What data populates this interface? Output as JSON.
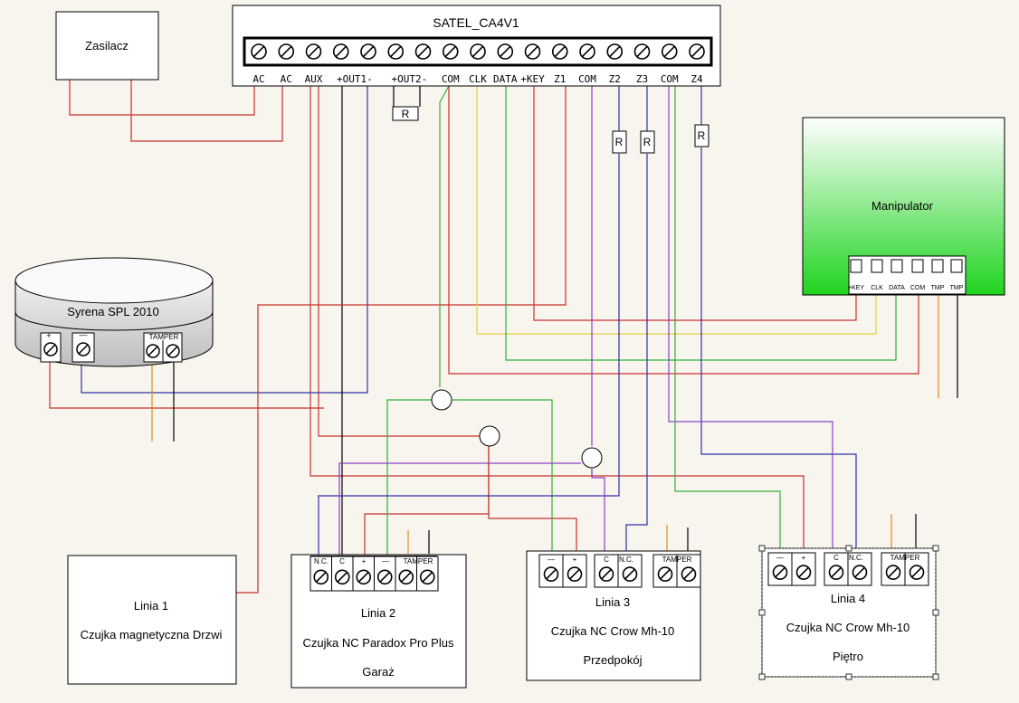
{
  "controller": {
    "title": "SATEL_CA4V1",
    "terminals": [
      "AC",
      "AC",
      "AUX",
      "+OUT1-",
      "+OUT2-",
      "COM",
      "CLK",
      "DATA",
      "+KEY",
      "Z1",
      "COM",
      "Z2",
      "Z3",
      "COM",
      "Z4"
    ]
  },
  "resistor_label": "R",
  "power_supply": {
    "label": "Zasilacz"
  },
  "siren": {
    "label": "Syrena SPL 2010",
    "plus": "+",
    "minus": "—",
    "tamper": "TAMPER"
  },
  "keypad": {
    "label": "Manipulator",
    "terminals": [
      "+KEY",
      "CLK",
      "DATA",
      "COM",
      "TMP",
      "TMP"
    ]
  },
  "zone1": {
    "line": "Linia 1",
    "desc": "Czujka magnetyczna Drzwi"
  },
  "zone2": {
    "line": "Linia 2",
    "desc": "Czujka NC Paradox Pro Plus",
    "place": "Garaż",
    "terms": [
      "N.C.",
      "C",
      "+",
      "—",
      "TAMPER"
    ]
  },
  "zone3": {
    "line": "Linia 3",
    "desc": "Czujka NC Crow Mh-10",
    "place": "Przedpokój",
    "terms": [
      "—",
      "+",
      "C",
      "N.C.",
      "TAMPER"
    ]
  },
  "zone4": {
    "line": "Linia 4",
    "desc": "Czujka NC Crow Mh-10",
    "place": "Piętro",
    "terms": [
      "—",
      "+",
      "C",
      "N.C.",
      "TAMPER"
    ]
  },
  "colors": {
    "red": "#c8302c",
    "blue": "#3030a8",
    "black": "#000000",
    "green": "#30b030",
    "yellow": "#e8d040",
    "purple": "#8a40c8",
    "orange": "#e08a20",
    "keypad_green": "#1fd41f"
  }
}
